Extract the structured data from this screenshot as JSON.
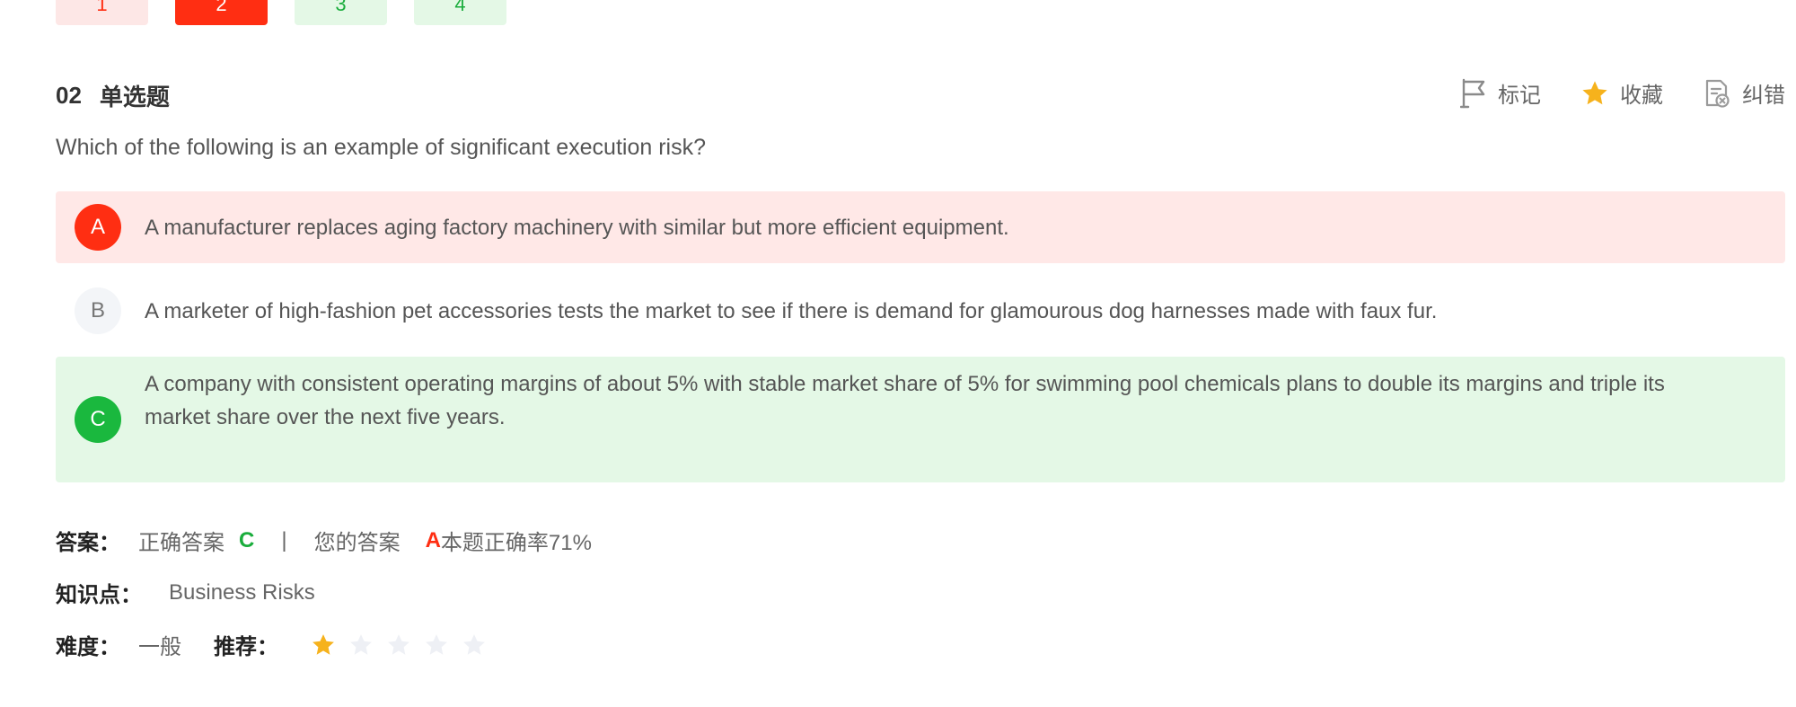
{
  "pager": {
    "items": [
      {
        "label": "1",
        "state": "wrong"
      },
      {
        "label": "2",
        "state": "current"
      },
      {
        "label": "3",
        "state": "right"
      },
      {
        "label": "4",
        "state": "right"
      }
    ]
  },
  "question": {
    "number": "02",
    "type": "单选题",
    "text": "Which of the following is an example of significant execution risk?"
  },
  "tools": {
    "mark_label": "标记",
    "mark_icon": "flag-icon",
    "favorite_label": "收藏",
    "favorite_icon": "star-icon",
    "report_label": "纠错",
    "report_icon": "report-error-icon"
  },
  "options": [
    {
      "letter": "A",
      "text": "A manufacturer replaces aging factory machinery with similar but more efficient equipment.",
      "state": "wrong-selected"
    },
    {
      "letter": "B",
      "text": "A marketer of high-fashion pet accessories tests the market to see if there is demand for glamourous dog harnesses made with faux fur.",
      "state": "neutral"
    },
    {
      "letter": "C",
      "text": "A company with consistent operating margins of about 5% with stable market share of 5% for swimming pool chemicals plans to double its margins and triple its market share over the next five years.",
      "state": "correct"
    }
  ],
  "answer": {
    "label": "答案：",
    "correct_label": "正确答案",
    "correct_value": "C",
    "separator": "|",
    "yours_label": "您的答案",
    "yours_value": "A",
    "rate_text": "本题正确率71%"
  },
  "knowledge": {
    "label": "知识点：",
    "value": "Business Risks"
  },
  "difficulty": {
    "label": "难度：",
    "value": "一般",
    "recommend_label": "推荐：",
    "stars_filled": 1,
    "stars_total": 5
  },
  "colors": {
    "wrong": "#ff2e12",
    "correct": "#1ab83e",
    "star_on": "#f6b21c",
    "star_off": "#eef0f5"
  }
}
